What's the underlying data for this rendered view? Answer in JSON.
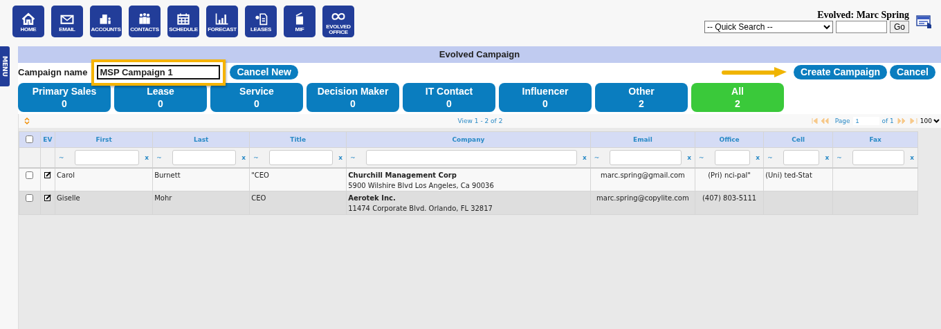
{
  "nav": [
    {
      "label": "HOME"
    },
    {
      "label": "EMAIL"
    },
    {
      "label": "ACCOUNTS"
    },
    {
      "label": "CONTACTS"
    },
    {
      "label": "SCHEDULE"
    },
    {
      "label": "FORECAST"
    },
    {
      "label": "LEASES"
    },
    {
      "label": "MIF"
    },
    {
      "label": "EVOLVED OFFICE"
    }
  ],
  "user": "Evolved: Marc Spring",
  "quick_search": {
    "value": "-- Quick Search --",
    "go": "Go"
  },
  "side_tab": "MENU",
  "panel_title": "Evolved Campaign",
  "campaign": {
    "label": "Campaign name",
    "value": "MSP Campaign 1",
    "cancel_new": "Cancel New",
    "create": "Create Campaign",
    "cancel": "Cancel"
  },
  "categories": [
    {
      "name": "Primary Sales",
      "count": "0",
      "selected": false
    },
    {
      "name": "Lease",
      "count": "0",
      "selected": false
    },
    {
      "name": "Service",
      "count": "0",
      "selected": false
    },
    {
      "name": "Decision Maker",
      "count": "0",
      "selected": false
    },
    {
      "name": "IT Contact",
      "count": "0",
      "selected": false
    },
    {
      "name": "Influencer",
      "count": "0",
      "selected": false
    },
    {
      "name": "Other",
      "count": "2",
      "selected": false
    },
    {
      "name": "All",
      "count": "2",
      "selected": true
    }
  ],
  "pager": {
    "view": "View 1 - 2 of 2",
    "page_label": "Page",
    "page": "1",
    "of": "of 1",
    "per_page": "100"
  },
  "table": {
    "select_all_checked": false,
    "filters": [
      {
        "operator": "~",
        "clear": "x"
      },
      {
        "operator": "~",
        "clear": "x"
      },
      {
        "operator": "~",
        "clear": "x"
      },
      {
        "operator": "~",
        "clear": "x"
      },
      {
        "operator": "~",
        "clear": "x"
      },
      {
        "operator": "~",
        "clear": "x"
      },
      {
        "operator": "~",
        "clear": "x"
      },
      {
        "operator": "~",
        "clear": "x"
      }
    ],
    "columns": [
      "EV",
      "First",
      "Last",
      "Title",
      "Company",
      "Email",
      "Office",
      "Cell",
      "Fax"
    ],
    "rows": [
      {
        "checked": false,
        "first": "Carol",
        "last": "Burnett",
        "title": "\"CEO",
        "company": "Churchill Management Corp",
        "address": "5900 Wilshire Blvd Los Angeles, Ca 90036",
        "email": "marc.spring@gmail.com",
        "office": "(Pri) nci-pal\"",
        "cell": "(Uni) ted-Stat",
        "fax": ""
      },
      {
        "checked": false,
        "first": "Giselle",
        "last": "Mohr",
        "title": "CEO",
        "company": "Aerotek Inc.",
        "address": "11474 Corporate Blvd. Orlando, FL 32817",
        "email": "marc.spring@copylite.com",
        "office": "(407) 803-5111",
        "cell": "",
        "fax": ""
      }
    ]
  }
}
